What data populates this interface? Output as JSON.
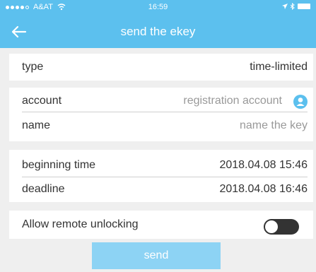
{
  "status_bar": {
    "carrier": "A&AT",
    "time": "16:59"
  },
  "nav": {
    "title": "send the ekey",
    "back_icon": "arrow-left-icon"
  },
  "type_row": {
    "label": "type",
    "value": "time-limited"
  },
  "account_row": {
    "label": "account",
    "placeholder": "registration account",
    "icon": "user-icon"
  },
  "name_row": {
    "label": "name",
    "placeholder": "name the key"
  },
  "begin_row": {
    "label": "beginning time",
    "value": "2018.04.08 15:46"
  },
  "deadline_row": {
    "label": "deadline",
    "value": "2018.04.08 16:46"
  },
  "remote_row": {
    "label": "Allow remote unlocking",
    "enabled": false
  },
  "send_button": {
    "label": "send"
  },
  "colors": {
    "accent": "#5cc0ee",
    "button": "#8dd3f4",
    "toggle_off": "#333333"
  }
}
